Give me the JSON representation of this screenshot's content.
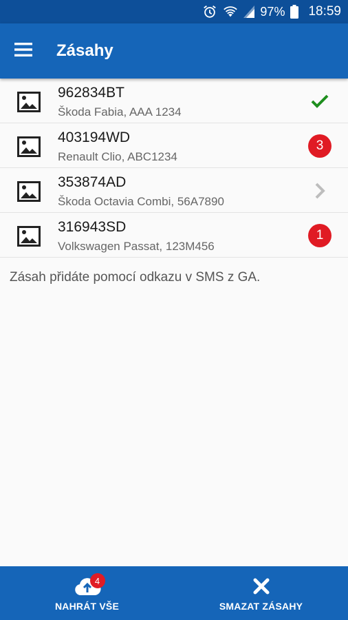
{
  "status_bar": {
    "battery": "97%",
    "time": "18:59"
  },
  "app_bar": {
    "title": "Zásahy",
    "menu_icon": "hamburger-menu-icon"
  },
  "items": [
    {
      "title": "962834BT",
      "subtitle": "Škoda Fabia, AAA 1234",
      "status": "check",
      "status_color": "#1e8e1e"
    },
    {
      "title": "403194WD",
      "subtitle": "Renault Clio, ABC1234",
      "status": "badge",
      "badge": "3",
      "status_color": "#e01b24"
    },
    {
      "title": "353874AD",
      "subtitle": "Škoda Octavia Combi, 56A7890",
      "status": "chevron",
      "status_color": "#bdbdbd"
    },
    {
      "title": "316943SD",
      "subtitle": "Volkswagen Passat, 123M456",
      "status": "badge",
      "badge": "1",
      "status_color": "#e01b24"
    }
  ],
  "hint": "Zásah přidáte pomocí odkazu v SMS z GA.",
  "bottom_bar": {
    "upload_label": "NAHRÁT VŠE",
    "upload_badge": "4",
    "delete_label": "SMAZAT ZÁSAHY"
  },
  "colors": {
    "primary": "#1565b8",
    "status_bar": "#0d4f99",
    "badge": "#e01b24",
    "check": "#1e8e1e"
  }
}
